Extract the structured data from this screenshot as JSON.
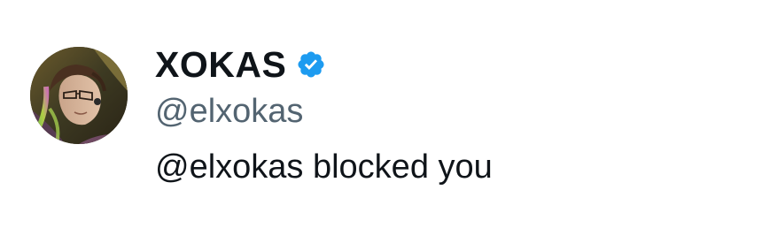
{
  "profile": {
    "display_name": "XOKAS",
    "handle": "@elxokas",
    "verified": true,
    "verified_badge_icon": "verified-badge-icon",
    "avatar": "avatar-photo"
  },
  "status": {
    "message": "@elxokas blocked you"
  },
  "colors": {
    "name": "#0f1419",
    "handle": "#536471",
    "verified_badge": "#1d9bf0",
    "background": "#ffffff"
  }
}
